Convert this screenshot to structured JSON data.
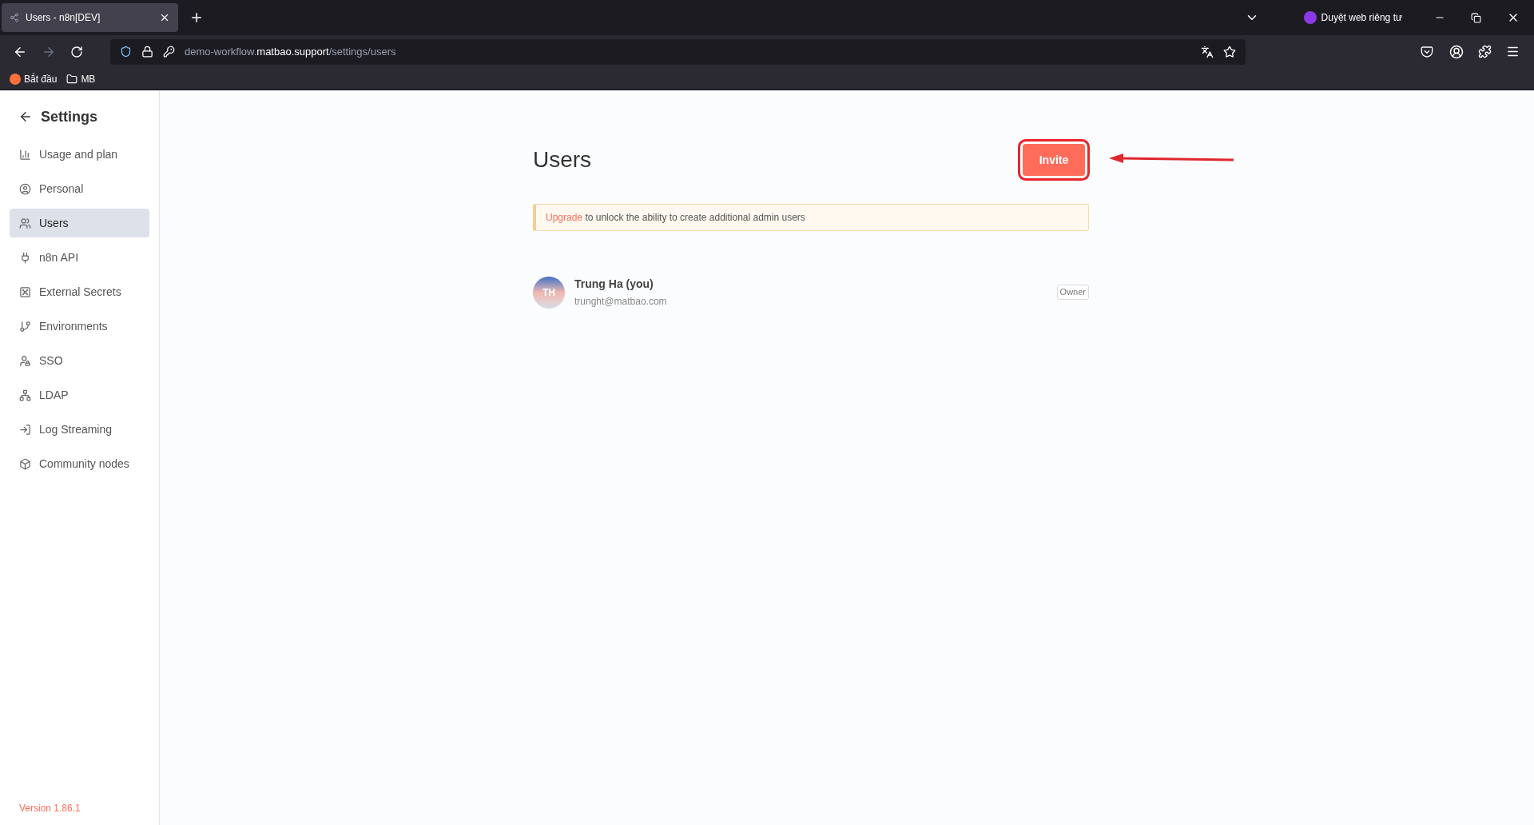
{
  "browser": {
    "tabs": [
      {
        "title": "Users - n8n[DEV]",
        "selected": true
      }
    ],
    "private_label": "Duyệt web riêng tư",
    "url": {
      "prefix": "demo-workflow.",
      "domain": "matbao.support",
      "path": "/settings/users"
    },
    "bookmarks": [
      "Bắt đầu",
      "MB"
    ]
  },
  "sidebar": {
    "title": "Settings",
    "items": [
      {
        "label": "Usage and plan",
        "selected": false
      },
      {
        "label": "Personal",
        "selected": false
      },
      {
        "label": "Users",
        "selected": true
      },
      {
        "label": "n8n API",
        "selected": false
      },
      {
        "label": "External Secrets",
        "selected": false
      },
      {
        "label": "Environments",
        "selected": false
      },
      {
        "label": "SSO",
        "selected": false
      },
      {
        "label": "LDAP",
        "selected": false
      },
      {
        "label": "Log Streaming",
        "selected": false
      },
      {
        "label": "Community nodes",
        "selected": false
      }
    ],
    "version": "Version 1.86.1"
  },
  "main": {
    "title": "Users",
    "invite_button": "Invite",
    "banner": {
      "link": "Upgrade",
      "text": "to unlock the ability to create additional admin users"
    },
    "users": [
      {
        "initials": "TH",
        "name": "Trung Ha (you)",
        "email": "trunght@matbao.com",
        "role": "Owner"
      }
    ]
  }
}
